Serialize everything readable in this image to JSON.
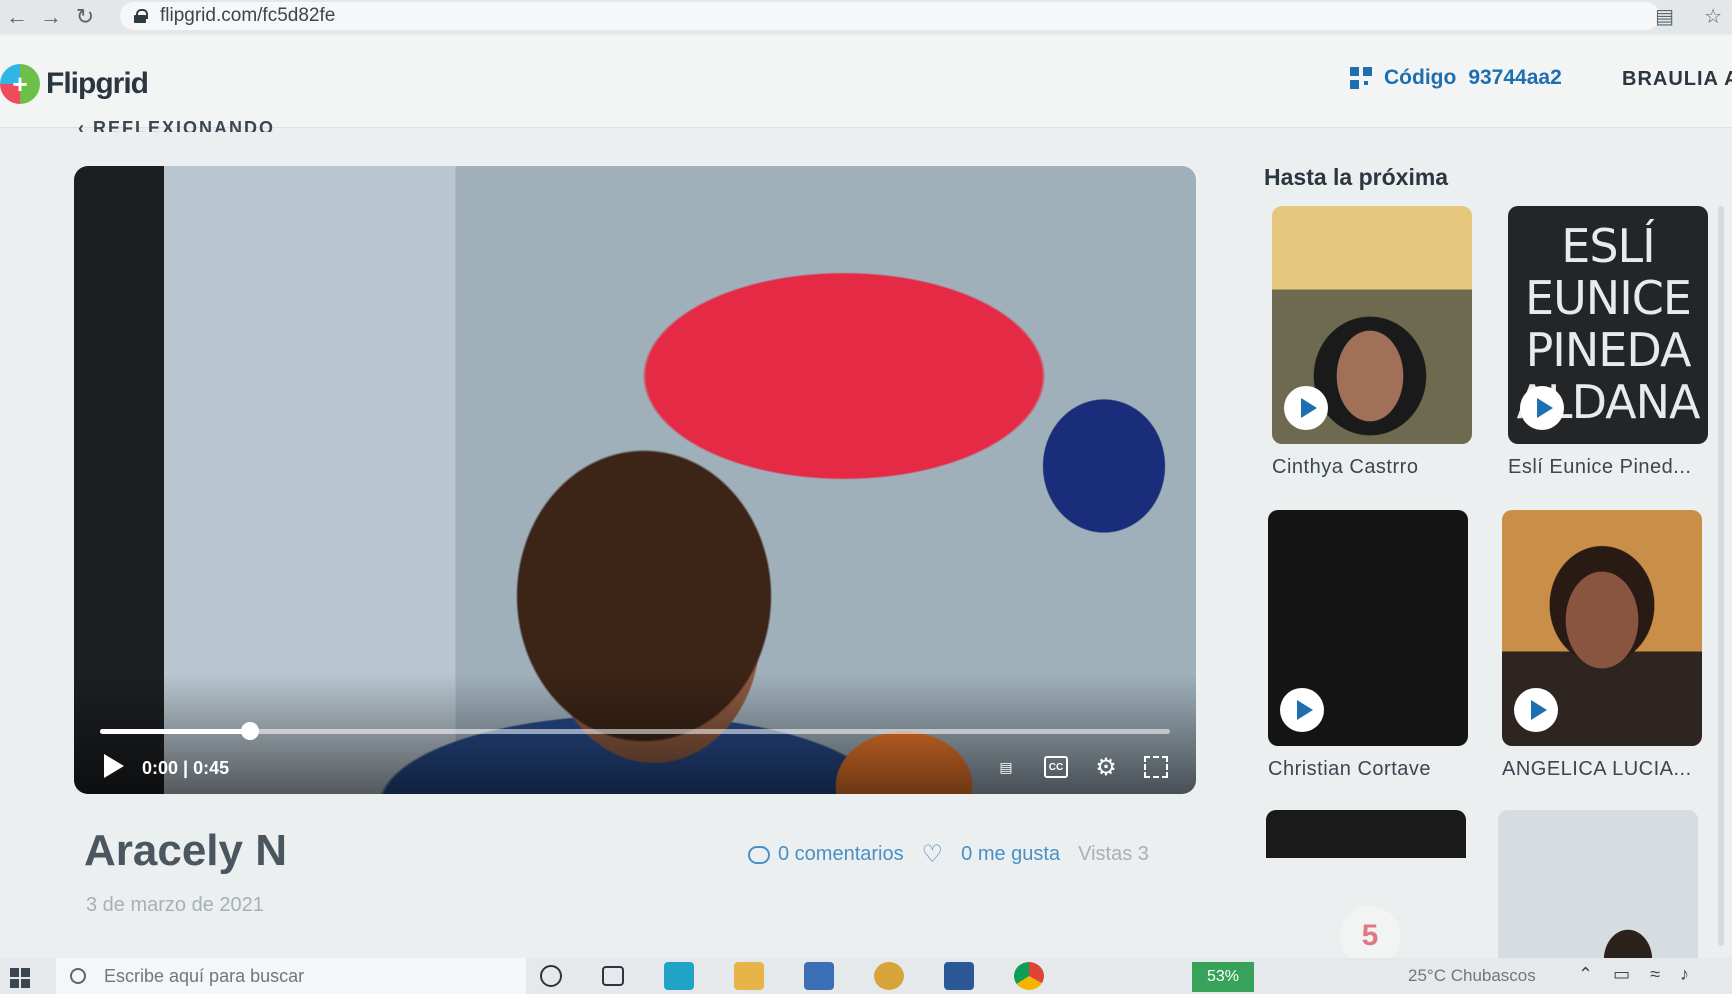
{
  "browser": {
    "url": "flipgrid.com/fc5d82fe",
    "back_icon": "arrow-left-icon",
    "forward_icon": "arrow-right-icon",
    "reload_icon": "reload-icon"
  },
  "header": {
    "logo_text": "Flipgrid",
    "code_label": "Código",
    "code_value": "93744aa2",
    "user_name": "BRAULIA A"
  },
  "breadcrumb": "REFLEXIONANDO",
  "video": {
    "current_time": "0:00",
    "duration": "0:45",
    "time_display": "0:00 | 0:45",
    "progress_fraction": 0.14,
    "cc_label": "CC"
  },
  "response": {
    "author": "Aracely N",
    "date": "3 de marzo de 2021",
    "comments": "0 comentarios",
    "likes": "0 me gusta",
    "views": "Vistas 3"
  },
  "sidebar": {
    "title": "Hasta la próxima",
    "cards": [
      {
        "name": "Cinthya Castrro"
      },
      {
        "name": "Eslí Eunice Pined...",
        "thumb_text": "ESLÍ EUNICE PINEDA ALDANA"
      },
      {
        "name": "Christian Cortave"
      },
      {
        "name": "ANGELICA LUCIA..."
      }
    ],
    "badge": "5"
  },
  "taskbar": {
    "search_placeholder": "Escribe aquí para buscar",
    "battery": "53%",
    "weather": "25°C  Chubascos"
  }
}
